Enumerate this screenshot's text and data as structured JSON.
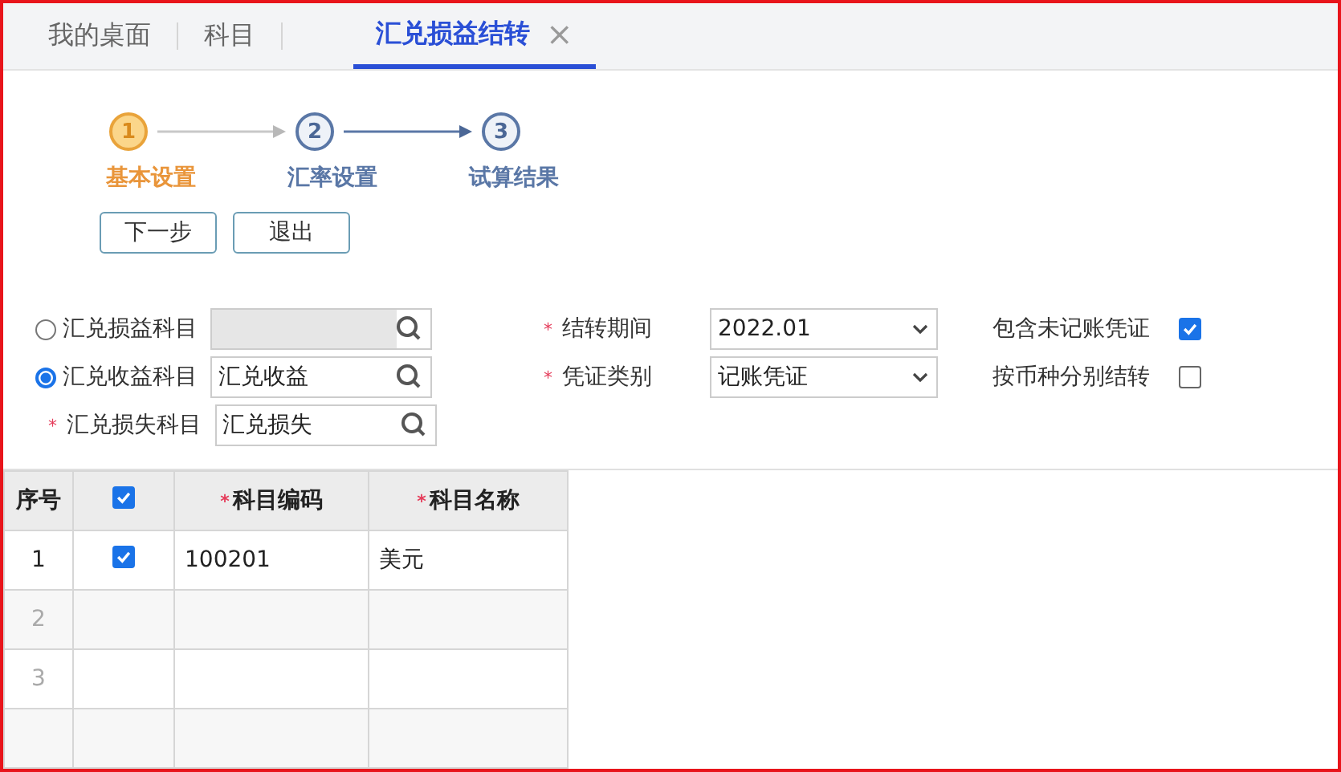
{
  "tabs": [
    {
      "label": "我的桌面",
      "selected": false,
      "closable": false
    },
    {
      "label": "科目",
      "selected": false,
      "closable": false
    },
    {
      "label": "汇兑损益结转",
      "selected": true,
      "closable": true,
      "close_glyph": "×"
    }
  ],
  "steps": [
    {
      "number": "1",
      "label": "基本设置",
      "selected": true
    },
    {
      "number": "2",
      "label": "汇率设置",
      "selected": false
    },
    {
      "number": "3",
      "label": "试算结果",
      "selected": false
    }
  ],
  "buttons": [
    "下一步",
    "退出"
  ],
  "account_fields": [
    {
      "kind": "radio",
      "label": "汇兑损益科目",
      "selected": false,
      "disabled": true
    },
    {
      "kind": "radio",
      "label": "汇兑收益科目",
      "selected": true,
      "disabled": false,
      "value": "汇兑收益"
    },
    {
      "kind": "required",
      "mark": "*",
      "label": "汇兑损失科目",
      "disabled": false,
      "value": "汇兑损失"
    }
  ],
  "selects": [
    {
      "mark": "*",
      "label": "结转期间",
      "value": "2022.01"
    },
    {
      "mark": "*",
      "label": "凭证类别",
      "value": "记账凭证"
    }
  ],
  "options": [
    {
      "label": "包含未记账凭证",
      "checked": true
    },
    {
      "label": "按币种分别结转",
      "checked": false
    }
  ],
  "table": {
    "columns": [
      {
        "label": "序号",
        "kind": "text"
      },
      {
        "kind": "checkbox",
        "checked": true
      },
      {
        "label": "科目编码",
        "kind": "required",
        "mark": "*"
      },
      {
        "label": "科目名称",
        "kind": "required",
        "mark": "*"
      }
    ],
    "rows": [
      {
        "kind": "data",
        "number": "1",
        "checked": true,
        "code": "100201",
        "name": "美元"
      },
      {
        "kind": "blank",
        "number": "2"
      },
      {
        "kind": "blank",
        "number": "3"
      },
      {
        "kind": "blank"
      }
    ]
  }
}
